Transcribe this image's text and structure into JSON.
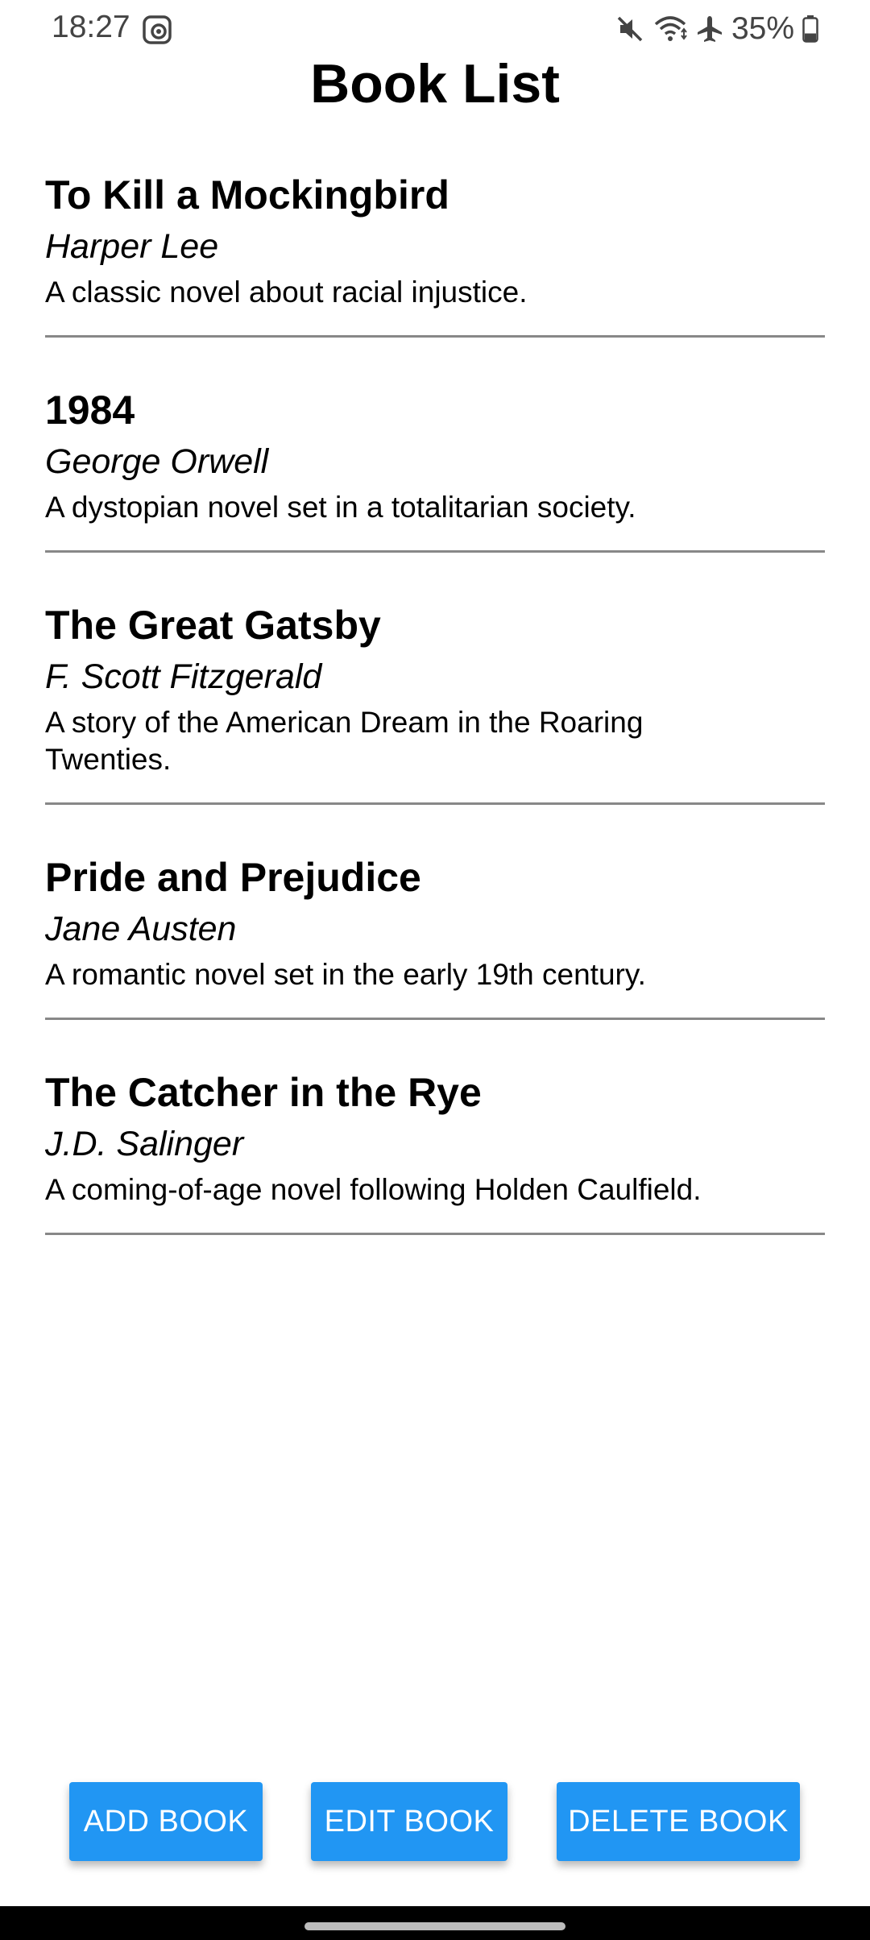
{
  "status_bar": {
    "time": "18:27",
    "left_icon": "screen-record-icon",
    "icons": [
      "mute-icon",
      "wifi-icon",
      "airplane-icon"
    ],
    "battery_percent": "35%",
    "battery_level": 0.35
  },
  "header": {
    "title": "Book List"
  },
  "books": [
    {
      "title": "To Kill a Mockingbird",
      "author": "Harper Lee",
      "description": "A classic novel about racial injustice."
    },
    {
      "title": "1984",
      "author": "George Orwell",
      "description": "A dystopian novel set in a totalitarian society."
    },
    {
      "title": "The Great Gatsby",
      "author": "F. Scott Fitzgerald",
      "description": "A story of the American Dream in the Roaring Twenties."
    },
    {
      "title": "Pride and Prejudice",
      "author": "Jane Austen",
      "description": "A romantic novel set in the early 19th century."
    },
    {
      "title": "The Catcher in the Rye",
      "author": "J.D. Salinger",
      "description": "A coming-of-age novel following Holden Caulfield."
    }
  ],
  "actions": {
    "add_label": "ADD BOOK",
    "edit_label": "EDIT BOOK",
    "delete_label": "DELETE BOOK"
  },
  "colors": {
    "accent": "#2196F3",
    "divider": "#888888",
    "nav_bar": "#000000"
  }
}
